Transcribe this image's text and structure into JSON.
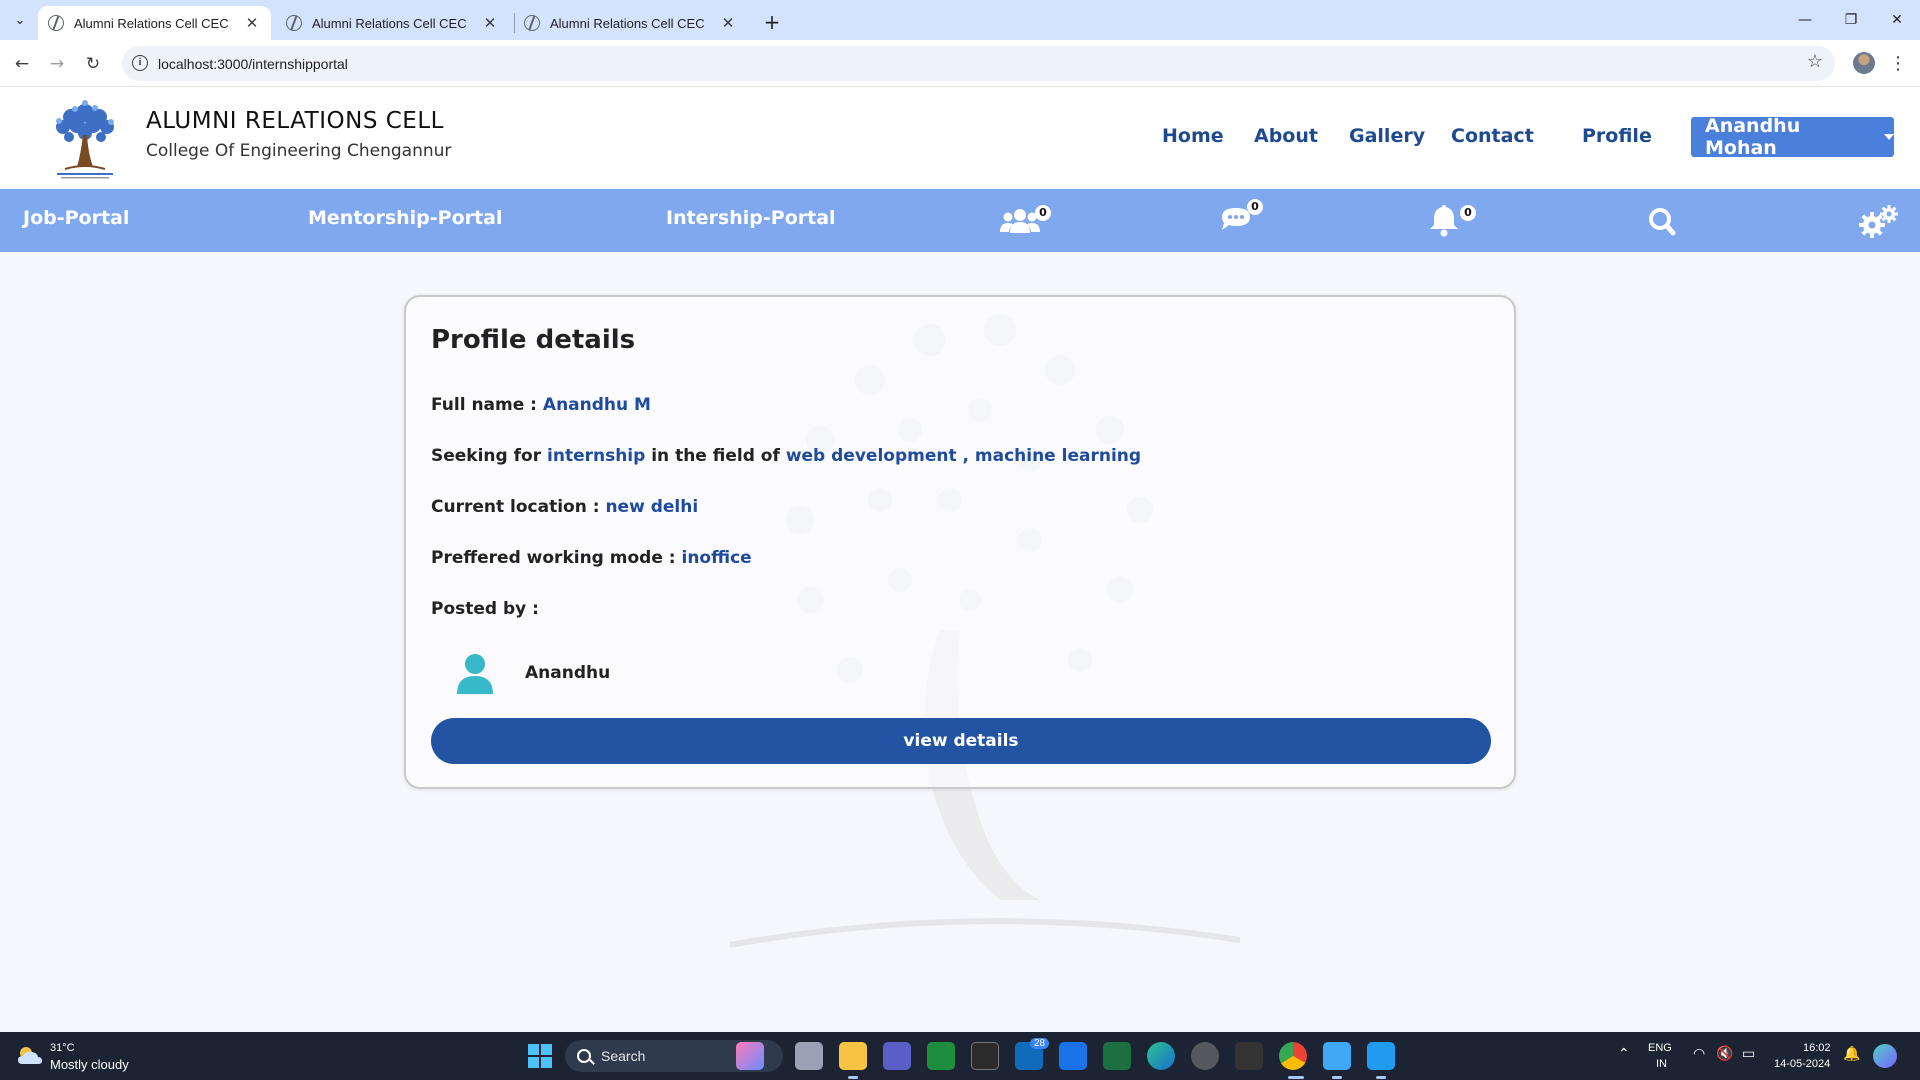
{
  "browser": {
    "tabs": [
      {
        "title": "Alumni Relations Cell CEC",
        "active": true
      },
      {
        "title": "Alumni Relations Cell CEC",
        "active": false
      },
      {
        "title": "Alumni Relations Cell CEC",
        "active": false
      }
    ],
    "url": "localhost:3000/internshipportal"
  },
  "header": {
    "title": "ALUMNI RELATIONS CELL",
    "subtitle": "College Of Engineering Chengannur",
    "nav": [
      "Home",
      "About",
      "Gallery",
      "Contact",
      "Profile"
    ],
    "user_button": "Anandhu Mohan"
  },
  "subnav": {
    "links": [
      "Job-Portal",
      "Mentorship-Portal",
      "Intership-Portal"
    ],
    "badges": {
      "connections": "0",
      "messages": "0",
      "notifications": "0"
    }
  },
  "card": {
    "title": "Profile details",
    "full_name_label": "Full name :",
    "full_name": "Anandhu M",
    "seeking_label": "Seeking for",
    "seeking_type": "internship",
    "field_label": "in the field of",
    "fields": "web development , machine learning",
    "location_label": "Current location :",
    "location": "new delhi",
    "mode_label": "Preffered working mode :",
    "mode": "inoffice",
    "posted_by_label": "Posted by :",
    "poster_name": "Anandhu",
    "view_button": "view details"
  },
  "taskbar": {
    "weather_temp": "31°C",
    "weather_desc": "Mostly cloudy",
    "search_label": "Search",
    "mail_badge": "28",
    "lang_top": "ENG",
    "lang_bottom": "IN",
    "time": "16:02",
    "date": "14-05-2024"
  },
  "colors": {
    "subnav_bg": "#7fa8ef",
    "nav_link": "#1e4b8f",
    "user_button_bg": "#4a7fdc",
    "value_text": "#1e4b9b",
    "view_button_bg": "#2354a4"
  }
}
